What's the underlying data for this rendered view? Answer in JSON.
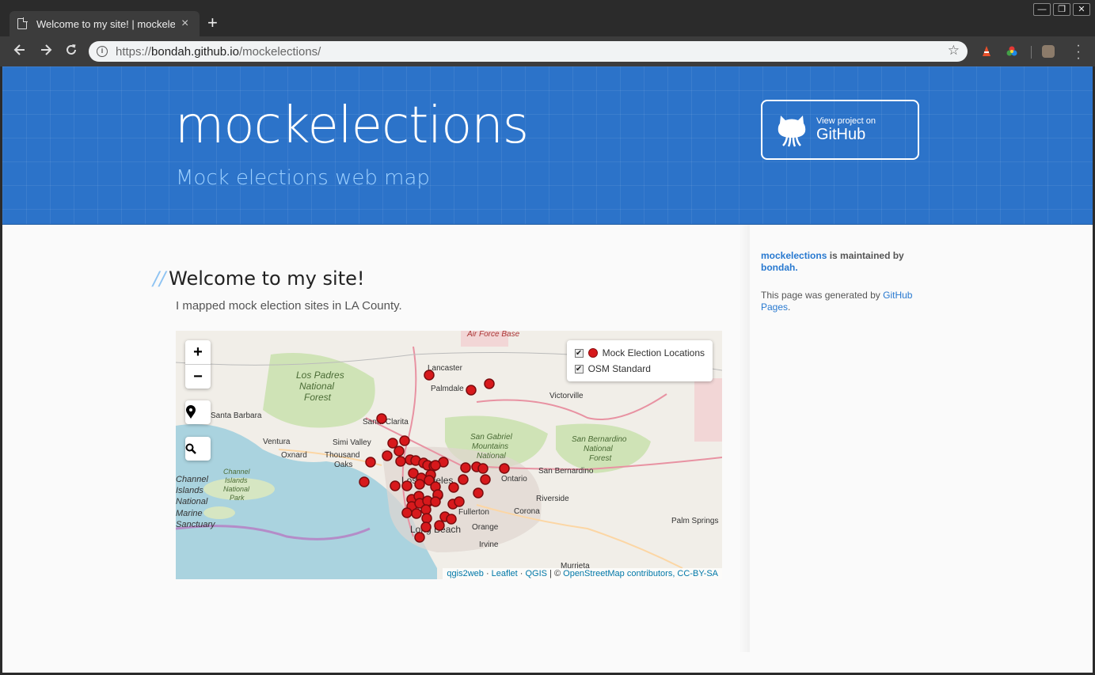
{
  "browser": {
    "tab_title": "Welcome to my site! | mockelec",
    "tab_close": "×",
    "new_tab": "+",
    "url_scheme": "https://",
    "url_host": "bondah.github.io",
    "url_path": "/mockelections/",
    "window_buttons": [
      "—",
      "❐",
      "✕"
    ]
  },
  "header": {
    "title": "mockelections",
    "subtitle": "Mock elections web map",
    "github_small": "View project on",
    "github_big": "GitHub"
  },
  "main": {
    "heading_prefix": "//",
    "heading": "Welcome to my site!",
    "intro": "I mapped mock election sites in LA County."
  },
  "map": {
    "zoom_in": "+",
    "zoom_out": "−",
    "legend": [
      {
        "label": "Mock Election Locations"
      },
      {
        "label": "OSM Standard"
      }
    ],
    "attribution": {
      "qgis2web": "qgis2web",
      "sep1": " · ",
      "leaflet": "Leaflet",
      "sep2": " · ",
      "qgis": "QGIS",
      "sep3": " | © ",
      "osm": "OpenStreetMap contributors, CC-BY-SA"
    },
    "place_labels": [
      "Air Force Base",
      "Lancaster",
      "Palmdale",
      "Victorville",
      "Los Padres",
      "National",
      "Forest",
      "Santa Barbara",
      "Santa Clarita",
      "Simi Valley",
      "Ventura",
      "Oxnard",
      "Thousand",
      "Oaks",
      "San Gabriel",
      "Mountains",
      "National",
      "San Bernardino",
      "National",
      "Forest",
      "Ontario",
      "San Bernardino",
      "Riverside",
      "Corona",
      "Fullerton",
      "Orange",
      "Irvine",
      "Long Beach",
      "Los Angeles",
      "Palm Springs",
      "Murrieta",
      "Channel",
      "Islands",
      "National",
      "Marine",
      "Sanctuary",
      "Channel",
      "Islands",
      "National",
      "Park"
    ],
    "colors": {
      "marker": "#d7191c",
      "ocean": "#aad3df",
      "land": "#f1eee8",
      "park": "#cfe3b6"
    }
  },
  "sidebar": {
    "project_link": "mockelections",
    "maintained_by": " is maintained by ",
    "author_link": "bondah.",
    "generated_text": "This page was generated by ",
    "pages_link": "GitHub Pages",
    "period": "."
  }
}
